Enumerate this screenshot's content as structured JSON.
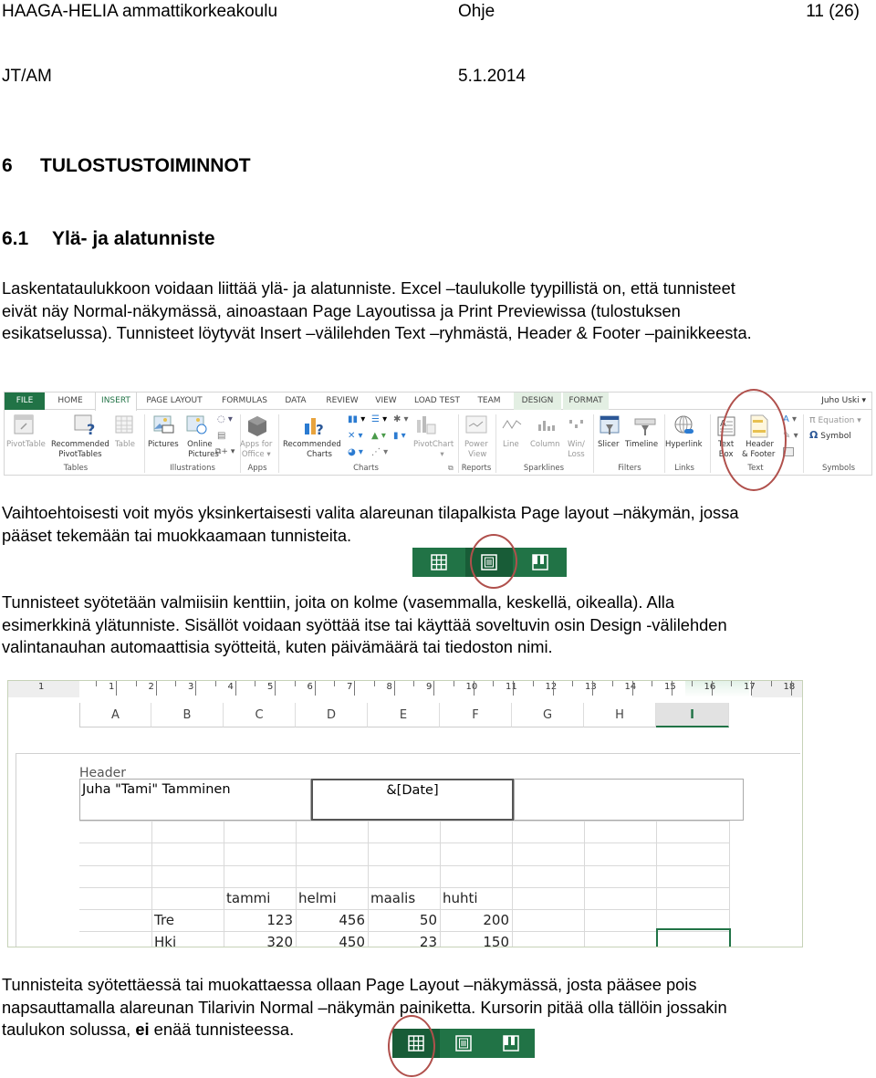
{
  "page_header": {
    "organization": "HAAGA-HELIA ammattikorkeakoulu",
    "doc_type": "Ohje",
    "page_number": "11 (26)",
    "author": "JT/AM",
    "date": "5.1.2014"
  },
  "headings": {
    "chapter_number": "6",
    "chapter_title": "TULOSTUSTOIMINNOT",
    "section_number": "6.1",
    "section_title": "Ylä- ja alatunniste"
  },
  "paragraphs": {
    "intro": [
      "Laskentataulukkoon voidaan liittää ylä- ja alatunniste. Excel –taulukolle tyypillistä on, että tunnisteet",
      "eivät näy Normal-näkymässä, ainoastaan Page Layoutissa ja Print Previewissa (tulostuksen",
      "esikatselussa). Tunnisteet löytyvät Insert –välilehden Text –ryhmästä, Header & Footer –painikkeesta."
    ],
    "alternative": [
      "Vaihtoehtoisesti voit myös yksinkertaisesti valita alareunan tilapalkista Page layout –näkymän, jossa",
      "pääset tekemään tai muokkaamaan tunnisteita."
    ],
    "fields": [
      "Tunnisteet syötetään valmiisiin kenttiin, joita on kolme (vasemmalla, keskellä, oikealla). Alla",
      "esimerkkinä ylätunniste. Sisällöt voidaan syöttää itse tai käyttää soveltuvin osin Design -välilehden",
      "valintanauhan automaattisia syötteitä, kuten päivämäärä tai tiedoston nimi."
    ],
    "exit": {
      "line1": "Tunnisteita syötettäessä tai muokattaessa ollaan Page Layout –näkymässä, josta pääsee pois",
      "line2": "napsauttamalla alareunan Tilarivin Normal –näkymän painiketta. Kursorin pitää olla tällöin jossakin",
      "line3_before": "taulukon solussa, ",
      "line3_bold": "ei",
      "line3_after": " enää tunnisteessa."
    }
  },
  "ribbon": {
    "tabs": [
      "FILE",
      "HOME",
      "INSERT",
      "PAGE LAYOUT",
      "FORMULAS",
      "DATA",
      "REVIEW",
      "VIEW",
      "LOAD TEST",
      "TEAM",
      "DESIGN",
      "FORMAT"
    ],
    "active_tab": "INSERT",
    "user": "Juho Uski",
    "groups": {
      "tables": {
        "label": "Tables",
        "buttons": [
          "PivotTable",
          "Recommended",
          "PivotTables",
          "Table"
        ]
      },
      "illustrations": {
        "label": "Illustrations",
        "buttons": [
          "Pictures",
          "Online",
          "Pictures"
        ]
      },
      "apps": {
        "label": "Apps",
        "buttons": [
          "Apps for",
          "Office"
        ]
      },
      "charts": {
        "label": "Charts",
        "buttons": [
          "Recommended",
          "Charts",
          "PivotChart"
        ]
      },
      "reports": {
        "label": "Reports",
        "buttons": [
          "Power",
          "View"
        ]
      },
      "sparklines": {
        "label": "Sparklines",
        "buttons": [
          "Line",
          "Column",
          "Win/",
          "Loss"
        ]
      },
      "filters": {
        "label": "Filters",
        "buttons": [
          "Slicer",
          "Timeline"
        ]
      },
      "links": {
        "label": "Links",
        "buttons": [
          "Hyperlink"
        ]
      },
      "text": {
        "label": "Text",
        "buttons": [
          "Text",
          "Box",
          "Header",
          "& Footer"
        ]
      },
      "symbols": {
        "label": "Symbols",
        "buttons": [
          "Equation",
          "Symbol"
        ]
      }
    }
  },
  "view_bar": {
    "buttons": [
      "normal-view",
      "page-layout-view",
      "page-break-preview"
    ],
    "highlighted_first": "page-layout-view",
    "highlighted_second": "normal-view"
  },
  "sheet": {
    "ruler_left": "1",
    "ruler_numbers": [
      "1",
      "2",
      "3",
      "4",
      "5",
      "6",
      "7",
      "8",
      "9",
      "10",
      "11",
      "12",
      "13",
      "14",
      "15",
      "16",
      "17",
      "18"
    ],
    "columns": [
      "A",
      "B",
      "C",
      "D",
      "E",
      "F",
      "G",
      "H",
      "I"
    ],
    "selected_column": "I",
    "header_label": "Header",
    "header_left": "Juha \"Tami\" Tamminen",
    "header_center": "&[Date]",
    "header_right": "",
    "table": {
      "months": [
        "tammi",
        "helmi",
        "maalis",
        "huhti"
      ],
      "rows": [
        {
          "label": "Tre",
          "values": [
            "123",
            "456",
            "50",
            "200"
          ]
        },
        {
          "label": "Hki",
          "values": [
            "320",
            "450",
            "23",
            "150"
          ]
        }
      ]
    }
  },
  "colors": {
    "excel_green": "#217346",
    "excel_green_dark": "#185c37",
    "annotation_circle": "#b0504c"
  }
}
